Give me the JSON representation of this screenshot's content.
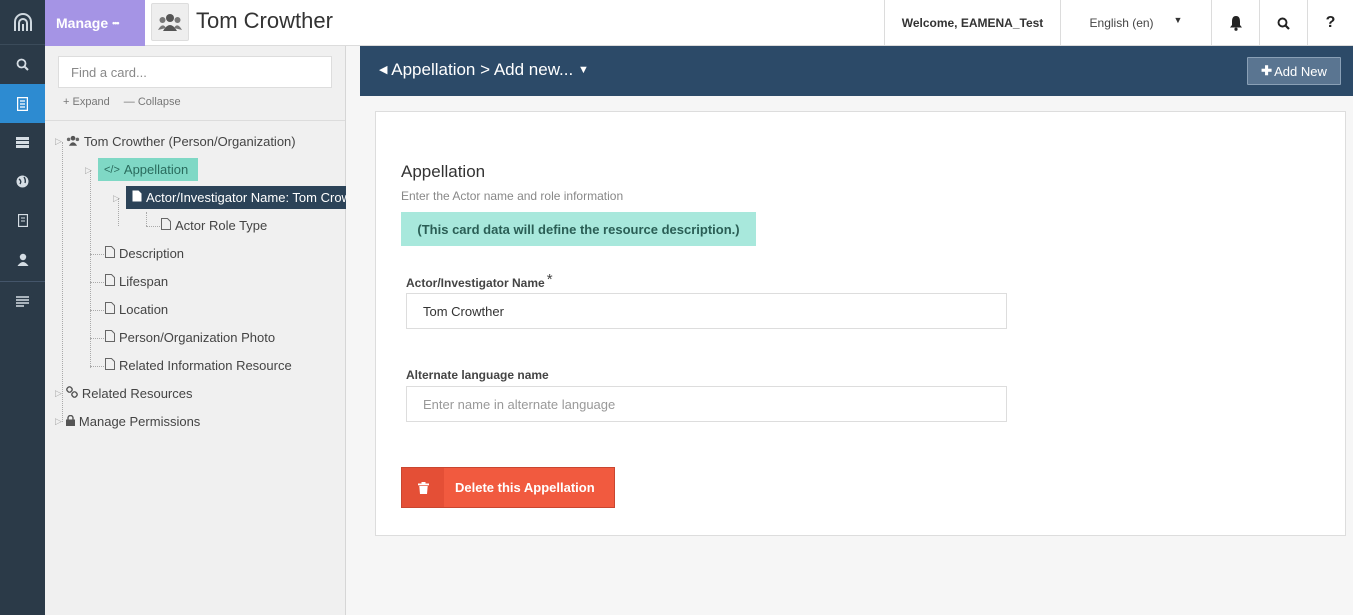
{
  "header": {
    "manage_label": "Manage",
    "manage_dots": "•••",
    "resource_title": "Tom Crowther",
    "welcome": "Welcome, EAMENA_Test",
    "language": "English (en)",
    "help": "?"
  },
  "rail": {
    "items": [
      "search",
      "resource",
      "list",
      "globe",
      "bookmark",
      "user",
      "notes"
    ]
  },
  "tree": {
    "search_placeholder": "Find a card...",
    "expand": "Expand",
    "collapse": "Collapse",
    "root": "Tom Crowther (Person/Organization)",
    "appellation": "Appellation",
    "actor_name": "Actor/Investigator Name: Tom Crowther",
    "actor_role": "Actor Role Type",
    "description": "Description",
    "lifespan": "Lifespan",
    "location": "Location",
    "photo": "Person/Organization Photo",
    "related_info": "Related Information Resource",
    "related_resources": "Related Resources",
    "permissions": "Manage Permissions"
  },
  "cardbar": {
    "breadcrumb": "Appellation > Add new...",
    "add_new": "Add New"
  },
  "card": {
    "title": "Appellation",
    "subtitle": "Enter the Actor name and role information",
    "note": "(This card data will define the resource description.)",
    "field1_label": "Actor/Investigator Name",
    "field1_required": "*",
    "field1_value": "Tom Crowther",
    "field2_label": "Alternate language name",
    "field2_placeholder": "Enter name in alternate language",
    "delete_label": "Delete this Appellation"
  },
  "colors": {
    "rail": "#2b3a48",
    "rail_active": "#2d8bd1",
    "manage": "#a594e5",
    "cardbar": "#2c4a68",
    "appellation_highlight": "#7fd8c5",
    "selected_node": "#2c4358",
    "note_bg": "#a8e8dc",
    "delete": "#f15a3f"
  }
}
